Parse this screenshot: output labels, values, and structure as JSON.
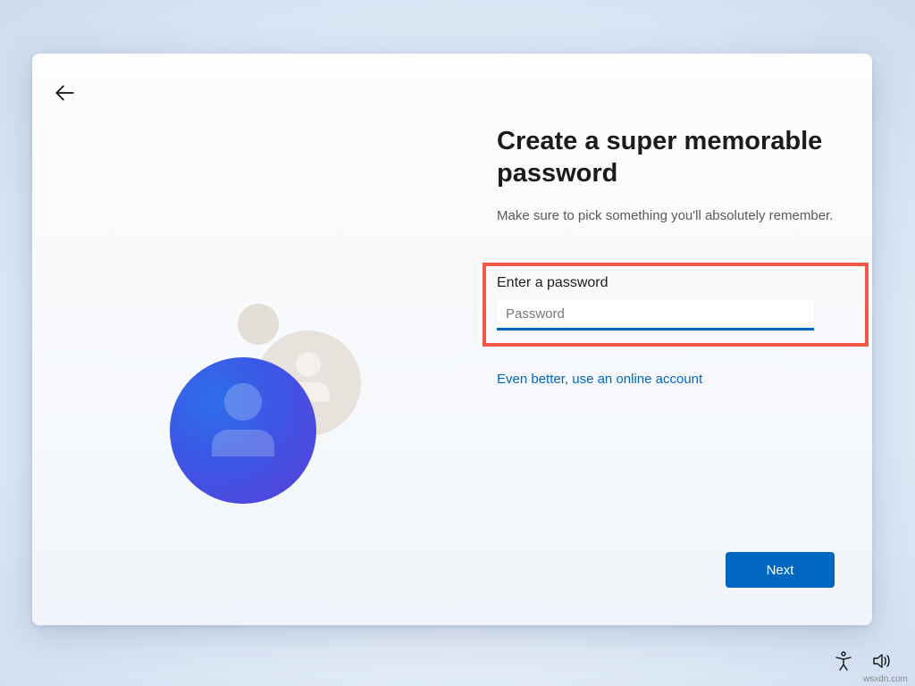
{
  "heading": "Create a super memorable password",
  "subtitle": "Make sure to pick something you'll absolutely remember.",
  "field": {
    "label": "Enter a password",
    "placeholder": "Password",
    "value": ""
  },
  "link_text": "Even better, use an online account",
  "next_label": "Next",
  "watermark": "wsxdn.com"
}
